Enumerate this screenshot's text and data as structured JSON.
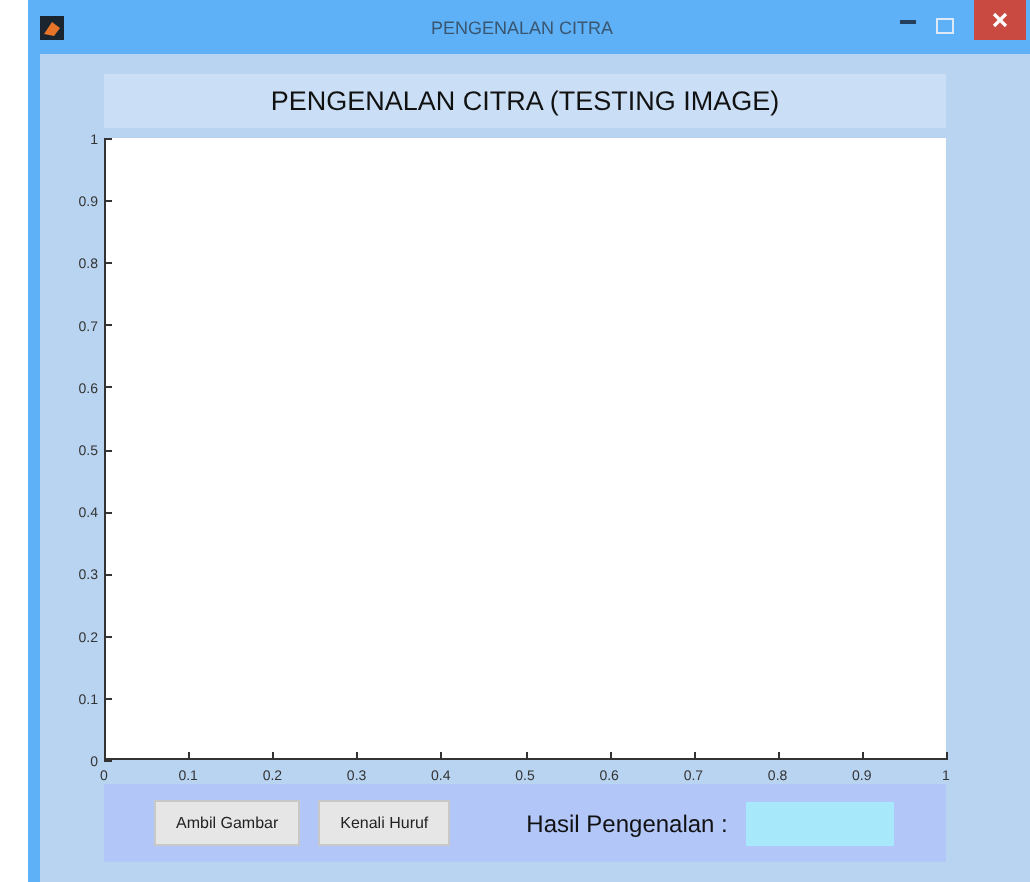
{
  "window": {
    "title": "PENGENALAN CITRA"
  },
  "panel_title": "PENGENALAN CITRA (TESTING IMAGE)",
  "axes": {
    "chart_data": {
      "type": "line",
      "xlim": [
        0,
        1
      ],
      "ylim": [
        0,
        1
      ],
      "xticks": [
        {
          "value": 0,
          "label": "0"
        },
        {
          "value": 0.1,
          "label": "0.1"
        },
        {
          "value": 0.2,
          "label": "0.2"
        },
        {
          "value": 0.3,
          "label": "0.3"
        },
        {
          "value": 0.4,
          "label": "0.4"
        },
        {
          "value": 0.5,
          "label": "0.5"
        },
        {
          "value": 0.6,
          "label": "0.6"
        },
        {
          "value": 0.7,
          "label": "0.7"
        },
        {
          "value": 0.8,
          "label": "0.8"
        },
        {
          "value": 0.9,
          "label": "0.9"
        },
        {
          "value": 1,
          "label": "1"
        }
      ],
      "yticks": [
        {
          "value": 0,
          "label": "0"
        },
        {
          "value": 0.1,
          "label": "0.1"
        },
        {
          "value": 0.2,
          "label": "0.2"
        },
        {
          "value": 0.3,
          "label": "0.3"
        },
        {
          "value": 0.4,
          "label": "0.4"
        },
        {
          "value": 0.5,
          "label": "0.5"
        },
        {
          "value": 0.6,
          "label": "0.6"
        },
        {
          "value": 0.7,
          "label": "0.7"
        },
        {
          "value": 0.8,
          "label": "0.8"
        },
        {
          "value": 0.9,
          "label": "0.9"
        },
        {
          "value": 1,
          "label": "1"
        }
      ]
    }
  },
  "buttons": [
    "Ambil Gambar",
    "Kenali Huruf"
  ],
  "result": {
    "label": "Hasil Pengenalan :"
  }
}
